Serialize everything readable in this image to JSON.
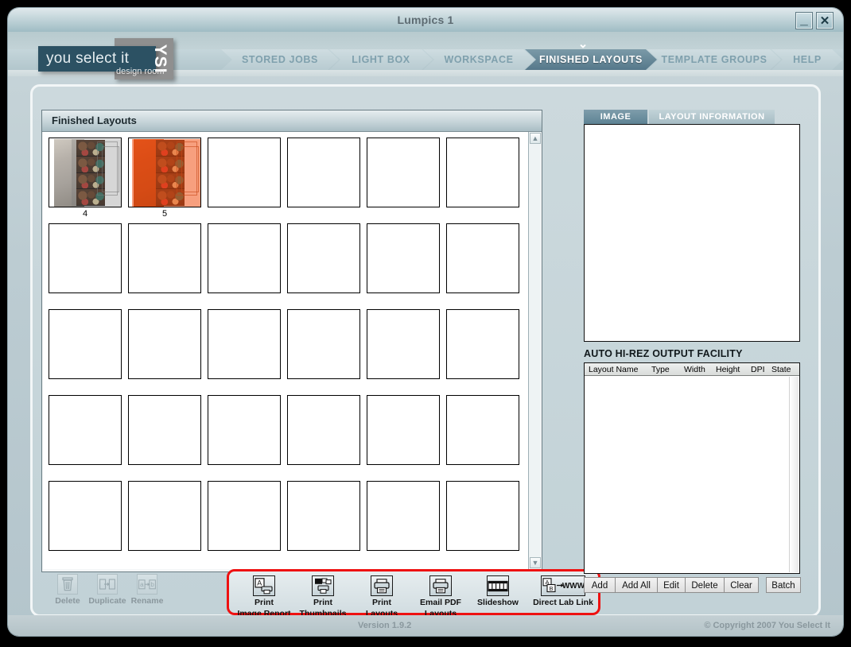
{
  "window": {
    "title": "Lumpics 1",
    "minimize_label": "_",
    "close_label": "✕"
  },
  "logo": {
    "main_text": "you select it",
    "badge_text": "YSI",
    "sub_text": "design room"
  },
  "nav": {
    "tabs": [
      {
        "label": "STORED JOBS",
        "active": false
      },
      {
        "label": "LIGHT BOX",
        "active": false
      },
      {
        "label": "WORKSPACE",
        "active": false
      },
      {
        "label": "FINISHED LAYOUTS",
        "active": true
      },
      {
        "label": "TEMPLATE GROUPS",
        "active": false
      },
      {
        "label": "HELP",
        "active": false
      }
    ],
    "active_marker": "⌄"
  },
  "left_panel": {
    "header": "Finished Layouts",
    "grid": {
      "columns": 6,
      "rows": 5,
      "cells": [
        {
          "label": "4",
          "filled": true,
          "style": "t4"
        },
        {
          "label": "5",
          "filled": true,
          "style": "t5"
        },
        {
          "label": "",
          "filled": false
        },
        {
          "label": "",
          "filled": false
        },
        {
          "label": "",
          "filled": false
        },
        {
          "label": "",
          "filled": false
        },
        {
          "label": "",
          "filled": false
        },
        {
          "label": "",
          "filled": false
        },
        {
          "label": "",
          "filled": false
        },
        {
          "label": "",
          "filled": false
        },
        {
          "label": "",
          "filled": false
        },
        {
          "label": "",
          "filled": false
        },
        {
          "label": "",
          "filled": false
        },
        {
          "label": "",
          "filled": false
        },
        {
          "label": "",
          "filled": false
        },
        {
          "label": "",
          "filled": false
        },
        {
          "label": "",
          "filled": false
        },
        {
          "label": "",
          "filled": false
        },
        {
          "label": "",
          "filled": false
        },
        {
          "label": "",
          "filled": false
        },
        {
          "label": "",
          "filled": false
        },
        {
          "label": "",
          "filled": false
        },
        {
          "label": "",
          "filled": false
        },
        {
          "label": "",
          "filled": false
        },
        {
          "label": "",
          "filled": false
        },
        {
          "label": "",
          "filled": false
        },
        {
          "label": "",
          "filled": false
        },
        {
          "label": "",
          "filled": false
        },
        {
          "label": "",
          "filled": false
        },
        {
          "label": "",
          "filled": false
        }
      ]
    },
    "scrollbar": {
      "up": "▲",
      "down": "▼"
    }
  },
  "toolbar": {
    "plain_buttons": [
      {
        "label": "Delete",
        "icon": "trash-icon",
        "glyph": "🗑",
        "disabled": true
      },
      {
        "label": "Duplicate",
        "icon": "duplicate-icon",
        "glyph": "",
        "disabled": true
      },
      {
        "label": "Rename",
        "icon": "rename-icon",
        "glyph": "",
        "disabled": true
      }
    ],
    "highlight_color": "#ee1111",
    "print_buttons": [
      {
        "label_line1": "Print",
        "label_line2": "Image Report",
        "icon": "print-image-report-icon"
      },
      {
        "label_line1": "Print",
        "label_line2": "Thumbnails",
        "icon": "print-thumbnails-icon"
      },
      {
        "label_line1": "Print",
        "label_line2": "Layouts",
        "icon": "print-layouts-icon"
      },
      {
        "label_line1": "Email PDF",
        "label_line2": "Layouts",
        "icon": "email-pdf-icon"
      },
      {
        "label_line1": "Slideshow",
        "label_line2": "",
        "icon": "slideshow-icon"
      },
      {
        "label_line1": "Direct Lab Link",
        "label_line2": "",
        "icon": "direct-lab-link-icon"
      }
    ]
  },
  "right_panel": {
    "tabs": [
      {
        "label": "IMAGE",
        "active": true
      },
      {
        "label": "LAYOUT INFORMATION",
        "active": false
      }
    ],
    "hirez_title": "AUTO HI-REZ OUTPUT FACILITY",
    "list_columns": [
      "Layout Name",
      "Type",
      "Width",
      "Height",
      "DPI",
      "State"
    ],
    "list_rows": [],
    "buttons": [
      "Add",
      "Add All",
      "Edit",
      "Delete",
      "Clear",
      "Batch"
    ]
  },
  "footer": {
    "version": "Version 1.9.2",
    "copyright": "© Copyright 2007 You Select It"
  }
}
